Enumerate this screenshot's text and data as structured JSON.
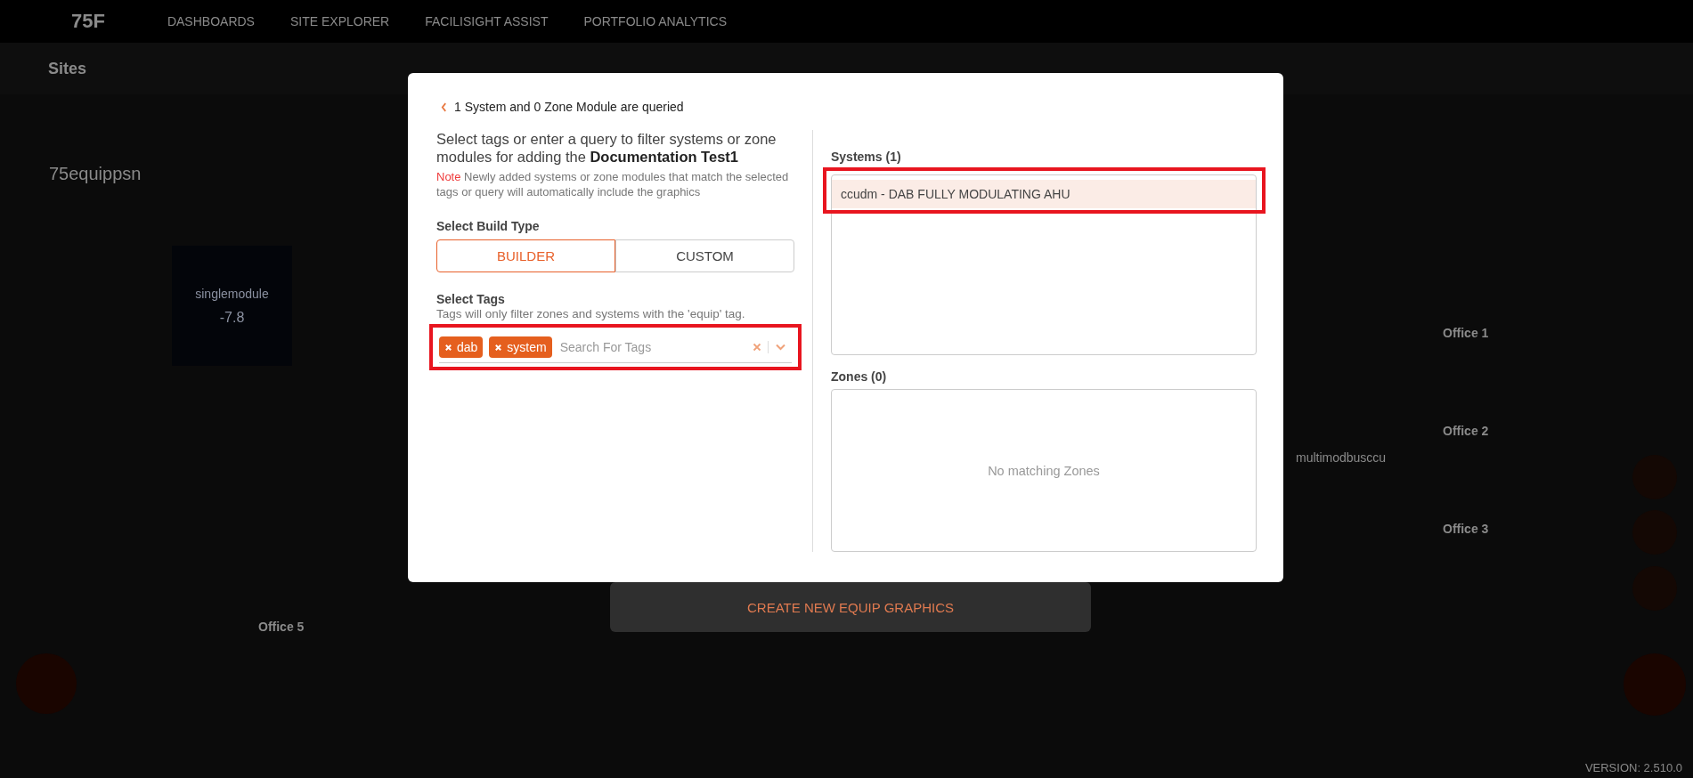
{
  "nav": {
    "logo": "75F",
    "items": [
      {
        "label": "DASHBOARDS",
        "selected": false
      },
      {
        "label": "SITE EXPLORER",
        "selected": false
      },
      {
        "label": "FACILISIGHT ASSIST",
        "selected": false
      },
      {
        "label": "PORTFOLIO ANALYTICS",
        "selected": false
      }
    ]
  },
  "toolbar": {
    "site_label": "Sites"
  },
  "page": {
    "title": "75equippsn",
    "create_button": "CREATE NEW EQUIP GRAPHICS",
    "version": "VERSION: 2.510.0",
    "rooms": [
      "Office 1",
      "Office 2",
      "Office 3",
      "Office 5",
      "multimodbusccu"
    ],
    "zone_card": {
      "name": "singlemodule",
      "reading": "-7.8"
    }
  },
  "modal": {
    "back_text": "1 System and 0 Zone Module are queried",
    "intro": "Select tags or enter a query to filter systems or zone modules for adding the **Documentation Test1**",
    "note_label": "Note",
    "note_text": "Newly added systems or zone modules that match the selected tags or query will automatically include the graphics",
    "build_type_label": "Select Build Type",
    "build_types": [
      {
        "label": "BUILDER",
        "selected": true
      },
      {
        "label": "CUSTOM",
        "selected": false
      }
    ],
    "tags_label": "Select Tags",
    "tags_hint": "Tags will only filter zones and systems with the 'equip' tag.",
    "tags": [
      {
        "label": "dab"
      },
      {
        "label": "system"
      }
    ],
    "tag_search": {
      "placeholder": "Search For Tags",
      "highlighted": true
    },
    "systems": {
      "title": "Systems (1)",
      "highlighted": true,
      "items": [
        {
          "label": "ccudm - DAB FULLY MODULATING AHU",
          "selected": true
        }
      ]
    },
    "zones": {
      "title": "Zones (0)",
      "empty_text": "No matching Zones"
    }
  }
}
